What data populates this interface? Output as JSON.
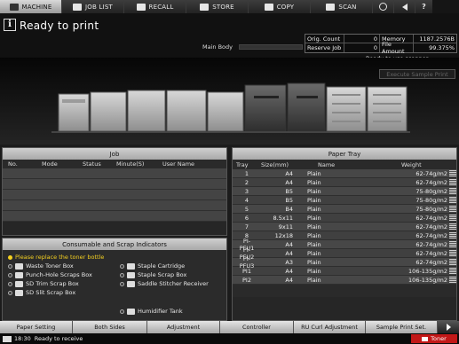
{
  "tabs": [
    {
      "label": "MACHINE",
      "icon": "printer-icon",
      "active": true
    },
    {
      "label": "JOB LIST",
      "icon": "list-icon",
      "active": false
    },
    {
      "label": "RECALL",
      "icon": "recall-icon",
      "active": false
    },
    {
      "label": "STORE",
      "icon": "store-icon",
      "active": false
    },
    {
      "label": "COPY",
      "icon": "copy-icon",
      "active": false
    },
    {
      "label": "SCAN",
      "icon": "scan-icon",
      "active": false
    }
  ],
  "topbar_icons": [
    "globe-icon",
    "speaker-icon",
    "help-icon"
  ],
  "help_label": "?",
  "header": {
    "info_glyph": "i",
    "status_title": "Ready to print",
    "main_body_label": "Main Body",
    "orig_count_label": "Orig. Count",
    "orig_count_value": "0",
    "memory_label": "Memory",
    "memory_value": "1187.2576B",
    "reserve_job_label": "Reserve Job",
    "reserve_job_value": "0",
    "file_amount_label": "File Amount",
    "file_amount_value": "99.375%",
    "scanner_status": "Ready to use scanner",
    "execute_sample_label": "Execute Sample Print"
  },
  "job": {
    "title": "Job",
    "columns": [
      "No.",
      "Mode",
      "Status",
      "Minute(S)",
      "User Name"
    ],
    "empty_rows": 5
  },
  "consumables": {
    "title": "Consumable and Scrap Indicators",
    "warning": "Please replace the toner bottle",
    "items": [
      {
        "label": "Waste Toner Box",
        "icon": "waste-toner-icon"
      },
      {
        "label": "Punch-Hole Scraps Box",
        "icon": "punch-hole-icon"
      },
      {
        "label": "SD Trim Scrap Box",
        "icon": "trim-scrap-icon"
      },
      {
        "label": "SD Slit Scrap Box",
        "icon": "slit-scrap-icon"
      },
      {
        "label": "Staple Cartridge",
        "icon": "staple-icon"
      },
      {
        "label": "Staple Scrap Box",
        "icon": "staple-scrap-icon"
      },
      {
        "label": "Saddle Stitcher Receiver",
        "icon": "saddle-stitcher-icon"
      },
      {
        "label": "Humidifier Tank",
        "icon": "humidifier-icon"
      }
    ]
  },
  "paper_tray": {
    "title": "Paper Tray",
    "columns": [
      "Tray",
      "Size(mm)",
      "Name",
      "Weight"
    ],
    "rows": [
      {
        "tray": "1",
        "size": "A4",
        "name": "Plain",
        "weight": "62-74g/m2"
      },
      {
        "tray": "2",
        "size": "A4",
        "name": "Plain",
        "weight": "62-74g/m2"
      },
      {
        "tray": "3",
        "size": "B5",
        "name": "Plain",
        "weight": "75-80g/m2"
      },
      {
        "tray": "4",
        "size": "B5",
        "name": "Plain",
        "weight": "75-80g/m2"
      },
      {
        "tray": "5",
        "size": "B4",
        "name": "Plain",
        "weight": "75-80g/m2"
      },
      {
        "tray": "6",
        "size": "8.5x11",
        "name": "Plain",
        "weight": "62-74g/m2"
      },
      {
        "tray": "7",
        "size": "9x11",
        "name": "Plain",
        "weight": "62-74g/m2"
      },
      {
        "tray": "8",
        "size": "12x18",
        "name": "Plain",
        "weight": "62-74g/m2"
      },
      {
        "tray": "PI-PFU1",
        "size": "A4",
        "name": "Plain",
        "weight": "62-74g/m2"
      },
      {
        "tray": "PI-PFU2",
        "size": "A4",
        "name": "Plain",
        "weight": "62-74g/m2"
      },
      {
        "tray": "PI-PFU3",
        "size": "A3",
        "name": "Plain",
        "weight": "62-74g/m2"
      },
      {
        "tray": "PI1",
        "size": "A4",
        "name": "Plain",
        "weight": "106-135g/m2"
      },
      {
        "tray": "PI2",
        "size": "A4",
        "name": "Plain",
        "weight": "106-135g/m2"
      }
    ]
  },
  "bottom_buttons": [
    "Paper Setting",
    "Both Sides",
    "Adjustment",
    "Controller",
    "RU Curl Adjustment",
    "Sample Print Set."
  ],
  "status_bar": {
    "time": "18:30",
    "message": "Ready to receive",
    "alert_label": "Toner"
  },
  "colors": {
    "warning": "#f5d020",
    "alert": "#c21818",
    "panel_header": "#bfbfbf"
  }
}
